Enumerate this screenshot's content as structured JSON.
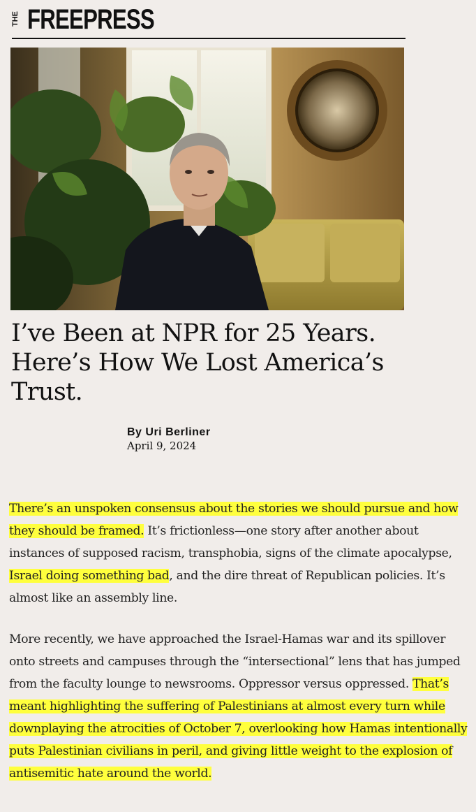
{
  "masthead": {
    "the": "THE",
    "name": "FREEPRESS"
  },
  "hero_image": {
    "alt": "Portrait of Uri Berliner seated in a living room with plants, window and round mirror"
  },
  "article": {
    "headline": "I’ve Been at NPR for 25 Years. Here’s How We Lost America’s Trust.",
    "byline": "By Uri Berliner",
    "date": "April 9, 2024",
    "p1": {
      "h1": "There’s an unspoken consensus about the stories we should pursue and how they should be framed.",
      "t1": " It’s frictionless—one story after another about instances of supposed racism, transphobia, signs of the climate apocalypse, ",
      "h2": "Israel doing something bad",
      "t2": ", and the dire threat of Republican policies. It’s almost like an assembly line."
    },
    "p2": {
      "t1": "More recently, we have approached the Israel-Hamas war and its spillover onto streets and campuses through the “intersectional” lens that has jumped from the faculty lounge to newsrooms. Oppressor versus oppressed. ",
      "h1": "That’s meant highlighting the suffering of Palestinians at almost every turn while downplaying the atrocities of October 7, overlooking how Hamas intentionally puts Palestinian civilians in peril, and giving little weight to the explosion of antisemitic hate around the world."
    }
  },
  "colors": {
    "background": "#f1edea",
    "highlight": "#ffff3d",
    "text": "#222222"
  }
}
